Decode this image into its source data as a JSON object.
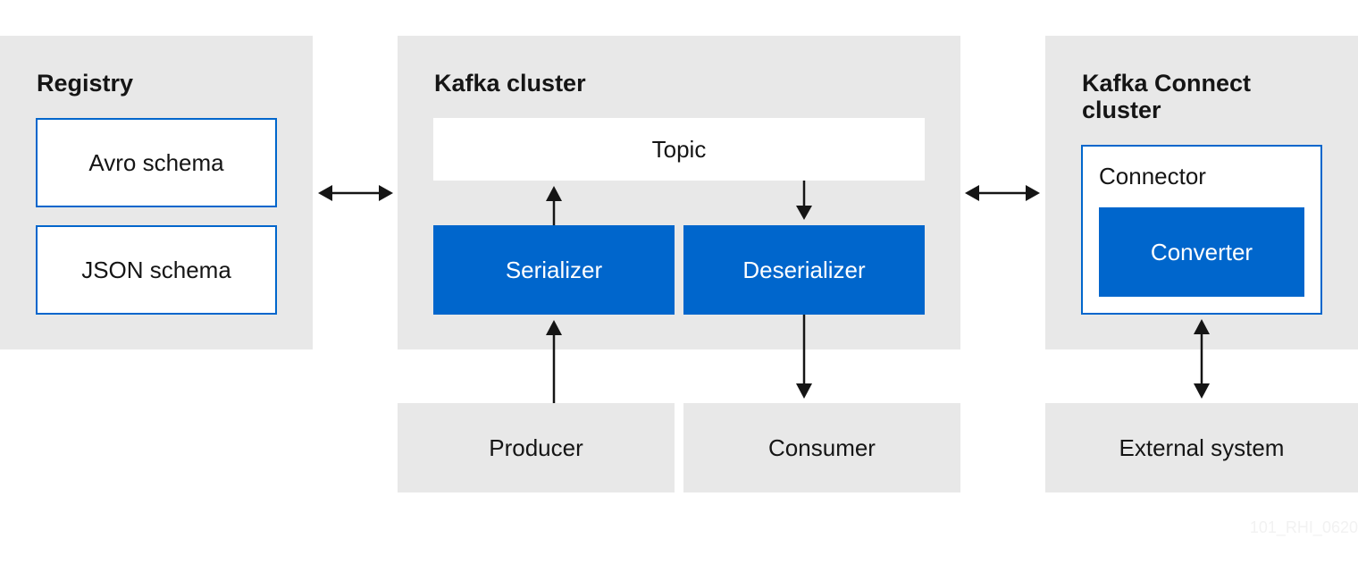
{
  "registry": {
    "title": "Registry",
    "items": [
      "Avro schema",
      "JSON schema"
    ]
  },
  "kafka_cluster": {
    "title": "Kafka cluster",
    "topic": "Topic",
    "serializer": "Serializer",
    "deserializer": "Deserializer"
  },
  "clients": {
    "producer": "Producer",
    "consumer": "Consumer"
  },
  "kafka_connect": {
    "title_line1": "Kafka Connect",
    "title_line2": "cluster",
    "connector": "Connector",
    "converter": "Converter"
  },
  "external": {
    "label": "External system"
  },
  "watermark": "101_RHI_0620",
  "colors": {
    "panel": "#e8e8e8",
    "accent": "#0066cc",
    "text": "#151515"
  }
}
